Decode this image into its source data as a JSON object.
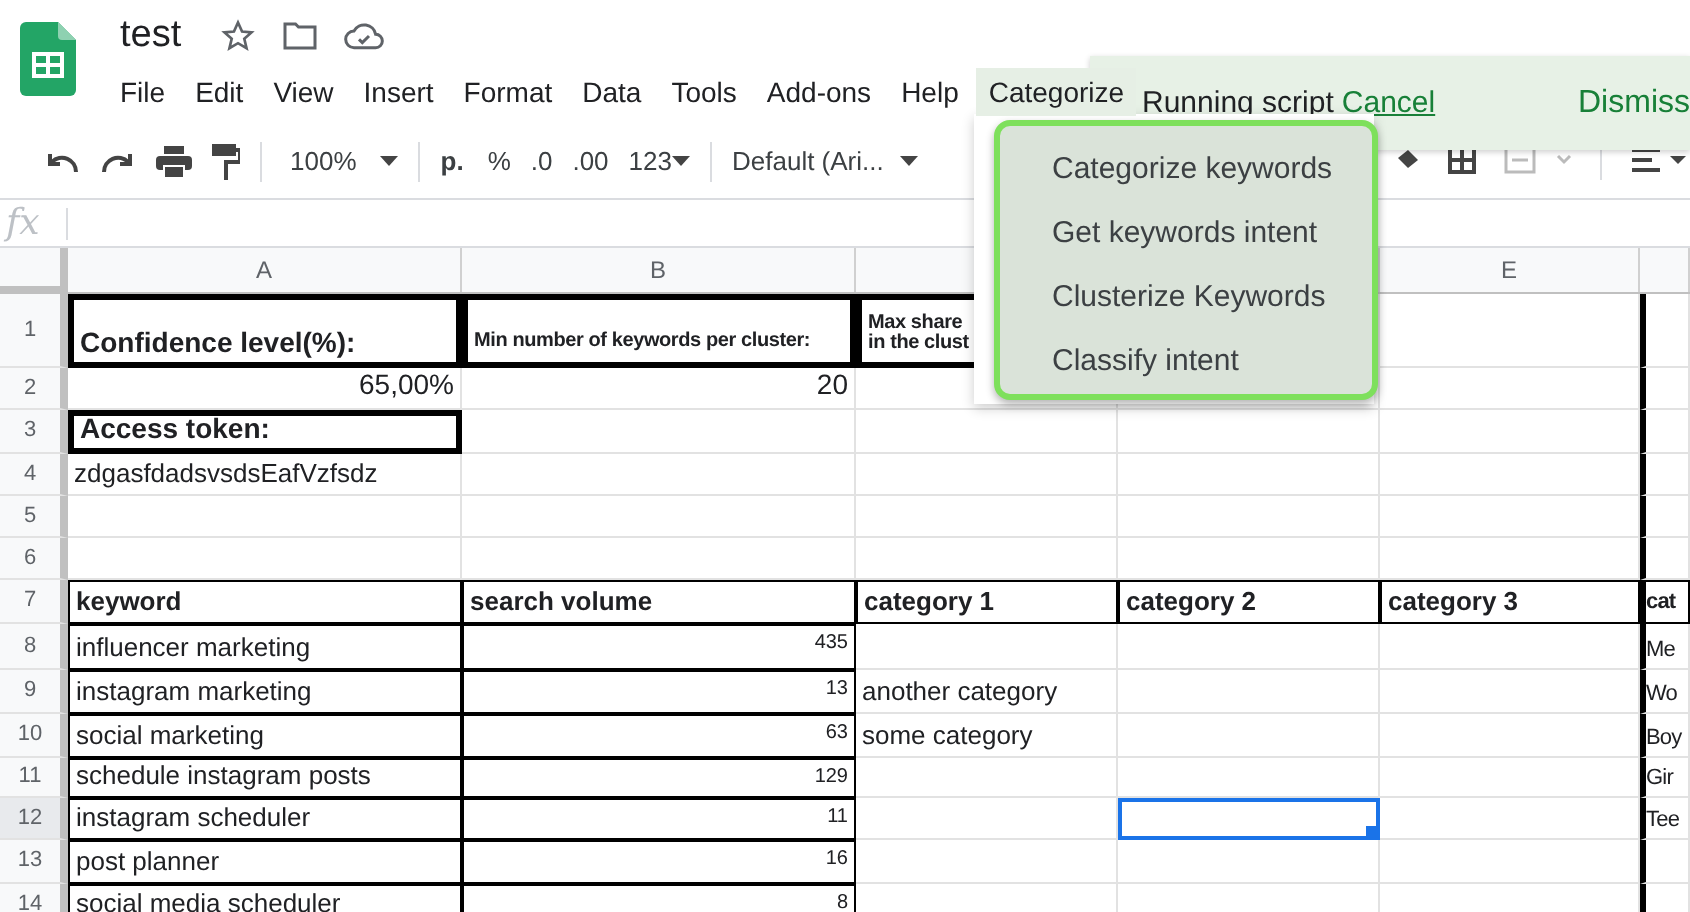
{
  "document": {
    "title": "test"
  },
  "menu_bar": [
    {
      "label": "File",
      "selected": false
    },
    {
      "label": "Edit",
      "selected": false
    },
    {
      "label": "View",
      "selected": false
    },
    {
      "label": "Insert",
      "selected": false
    },
    {
      "label": "Format",
      "selected": false
    },
    {
      "label": "Data",
      "selected": false
    },
    {
      "label": "Tools",
      "selected": false
    },
    {
      "label": "Add-ons",
      "selected": false
    },
    {
      "label": "Help",
      "selected": false
    },
    {
      "label": "Categorize",
      "selected": true
    }
  ],
  "toast": {
    "message": "Running script",
    "link": "Cancel",
    "action": "Dismiss"
  },
  "toolbar": {
    "zoom": "100%",
    "currency": "p.",
    "percent": "%",
    "decrease_decimals": ".0",
    "increase_decimals": ".00",
    "number_format": "123",
    "font": "Default (Ari..."
  },
  "formula_bar": {
    "label": "fx"
  },
  "dropdown_menu": [
    {
      "label": "Categorize keywords"
    },
    {
      "label": "Get keywords intent"
    },
    {
      "label": "Clusterize Keywords"
    },
    {
      "label": "Classify intent"
    }
  ],
  "columns": [
    {
      "label": "A"
    },
    {
      "label": "B"
    },
    {},
    {},
    {
      "label": "E"
    },
    {}
  ],
  "rows": [
    {
      "number": "1",
      "cells": [
        {
          "text": "Confidence level(%):",
          "kind": "label-boxed",
          "selected": false
        },
        {
          "text": "Min number of keywords per cluster:",
          "kind": "small-label-boxed",
          "selected": false
        },
        {
          "lines": [
            "Max share",
            "in the clust"
          ],
          "kind": "small-label-boxed",
          "selected": false
        },
        {
          "selected": false
        },
        {
          "selected": false
        },
        {
          "selected": false
        }
      ]
    },
    {
      "number": "2",
      "cells": [
        {
          "text": "65,00%",
          "kind": "value",
          "selected": false
        },
        {
          "text": "20",
          "kind": "value",
          "selected": false
        },
        {
          "selected": false
        },
        {
          "selected": false
        },
        {
          "selected": false
        },
        {
          "selected": false
        }
      ]
    },
    {
      "number": "3",
      "cells": [
        {
          "text": "Access token:",
          "kind": "label-boxed",
          "selected": false
        },
        {
          "selected": false
        },
        {
          "selected": false
        },
        {
          "selected": false
        },
        {
          "selected": false
        },
        {
          "selected": false
        }
      ]
    },
    {
      "number": "4",
      "cells": [
        {
          "text": "zdgasfdadsvsdsEafVzfsdz",
          "kind": "text",
          "selected": false
        },
        {
          "selected": false
        },
        {
          "selected": false
        },
        {
          "selected": false
        },
        {
          "selected": false
        },
        {
          "selected": false
        }
      ]
    },
    {
      "number": "5",
      "cells": [
        {
          "selected": false
        },
        {
          "selected": false
        },
        {
          "selected": false
        },
        {
          "selected": false
        },
        {
          "selected": false
        },
        {
          "selected": false
        }
      ]
    },
    {
      "number": "6",
      "cells": [
        {
          "selected": false
        },
        {
          "selected": false
        },
        {
          "selected": false
        },
        {
          "selected": false
        },
        {
          "selected": false
        },
        {
          "selected": false
        }
      ]
    },
    {
      "number": "7",
      "cells": [
        {
          "text": "keyword",
          "kind": "header-ruled",
          "selected": false
        },
        {
          "text": "search volume",
          "kind": "header-ruled",
          "selected": false
        },
        {
          "text": "category 1",
          "kind": "header-ruled",
          "selected": false
        },
        {
          "text": "category 2",
          "kind": "header-ruled",
          "selected": false
        },
        {
          "text": "category 3",
          "kind": "header-ruled",
          "selected": false
        },
        {
          "text": "cat",
          "kind": "header-ruled",
          "selected": false
        }
      ]
    },
    {
      "number": "8",
      "cells": [
        {
          "text": "influencer marketing",
          "kind": "text-ruled",
          "selected": false
        },
        {
          "text": "435",
          "kind": "number-ruled",
          "selected": false
        },
        {
          "selected": false
        },
        {
          "selected": false
        },
        {
          "selected": false
        },
        {
          "text": "Me",
          "kind": "text",
          "selected": false
        }
      ]
    },
    {
      "number": "9",
      "cells": [
        {
          "text": "instagram marketing",
          "kind": "text-ruled",
          "selected": false
        },
        {
          "text": "13",
          "kind": "number-ruled",
          "selected": false
        },
        {
          "text": "another category",
          "kind": "text",
          "selected": false
        },
        {
          "selected": false
        },
        {
          "selected": false
        },
        {
          "text": "Wo",
          "kind": "text",
          "selected": false
        }
      ]
    },
    {
      "number": "10",
      "cells": [
        {
          "text": "social marketing",
          "kind": "text-ruled",
          "selected": false
        },
        {
          "text": "63",
          "kind": "number-ruled",
          "selected": false
        },
        {
          "text": "some category",
          "kind": "text",
          "selected": false
        },
        {
          "selected": false
        },
        {
          "selected": false
        },
        {
          "text": "Boy",
          "kind": "text",
          "selected": false
        }
      ]
    },
    {
      "number": "11",
      "cells": [
        {
          "text": "schedule instagram posts",
          "kind": "text-ruled",
          "selected": false
        },
        {
          "text": "129",
          "kind": "number-ruled",
          "selected": false
        },
        {
          "selected": false
        },
        {
          "selected": false
        },
        {
          "selected": false
        },
        {
          "text": "Gir",
          "kind": "text",
          "selected": false
        }
      ]
    },
    {
      "number": "12",
      "cells": [
        {
          "text": "instagram scheduler",
          "kind": "text-ruled",
          "selected": false
        },
        {
          "text": "11",
          "kind": "number-ruled",
          "selected": false
        },
        {
          "selected": false
        },
        {
          "selected": true
        },
        {
          "selected": false
        },
        {
          "text": "Tee",
          "kind": "text",
          "selected": false
        }
      ]
    },
    {
      "number": "13",
      "cells": [
        {
          "text": "post planner",
          "kind": "text-ruled",
          "selected": false
        },
        {
          "text": "16",
          "kind": "number-ruled",
          "selected": false
        },
        {
          "selected": false
        },
        {
          "selected": false
        },
        {
          "selected": false
        },
        {
          "selected": false
        }
      ]
    },
    {
      "number": "14",
      "cells": [
        {
          "text": "social media scheduler",
          "kind": "text-ruled",
          "selected": false
        },
        {
          "text": "8",
          "kind": "number-ruled",
          "selected": false
        },
        {
          "selected": false
        },
        {
          "selected": false
        },
        {
          "selected": false
        },
        {
          "selected": false
        }
      ]
    }
  ]
}
